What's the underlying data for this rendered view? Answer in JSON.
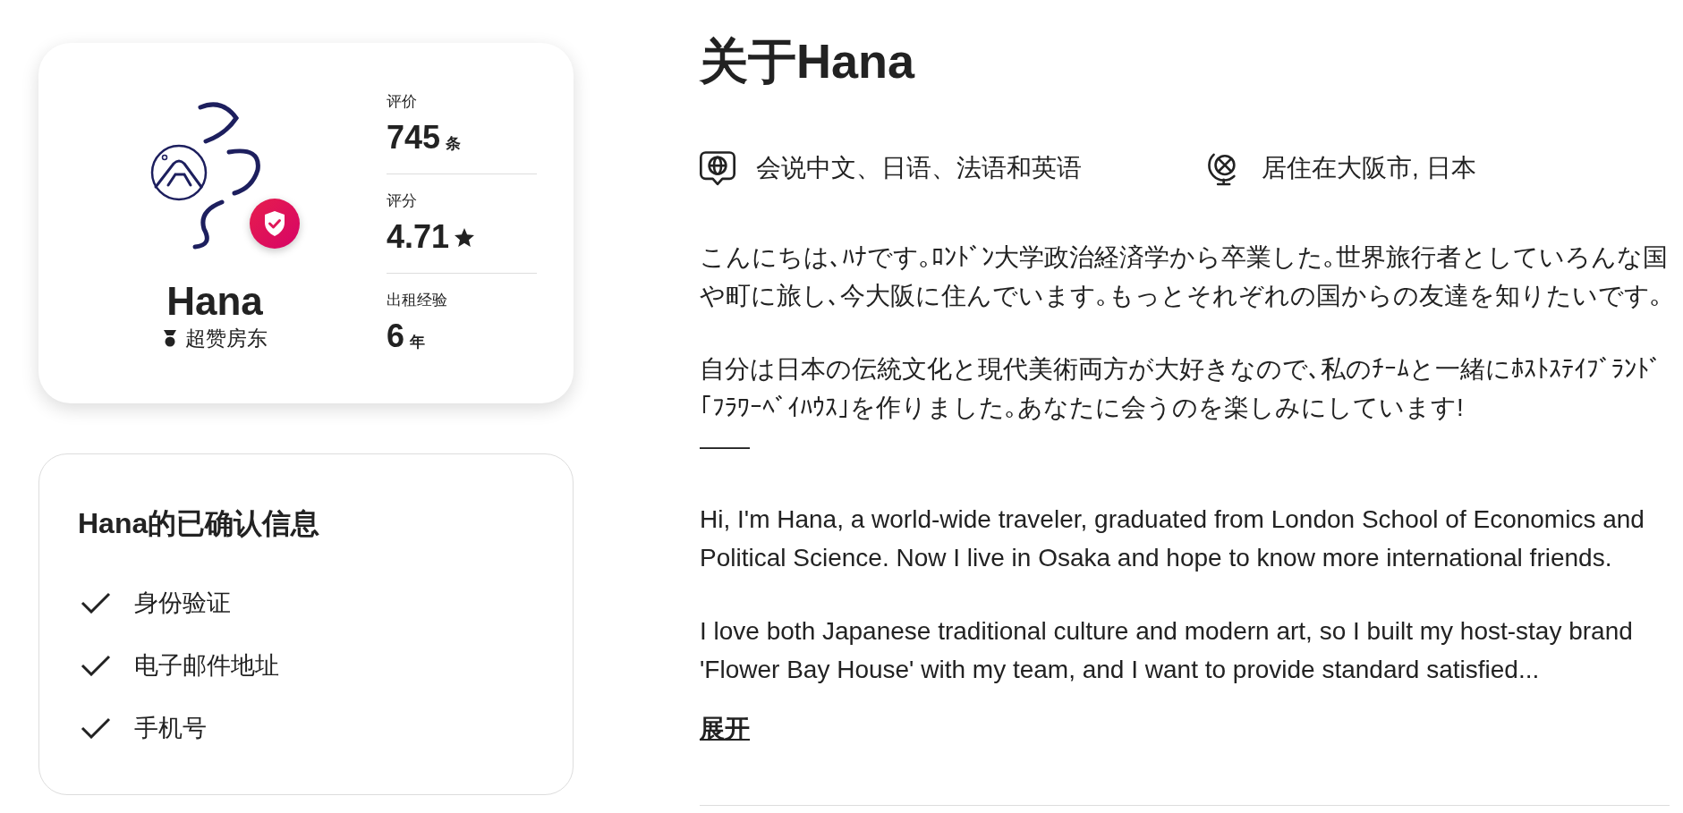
{
  "host_card": {
    "name": "Hana",
    "badge": "超赞房东",
    "stats": [
      {
        "kind": "count",
        "label": "评价",
        "value": "745",
        "unit": "条"
      },
      {
        "kind": "rating",
        "label": "评分",
        "value": "4.71"
      },
      {
        "kind": "count",
        "label": "出租经验",
        "value": "6",
        "unit": "年"
      }
    ]
  },
  "verified_info": {
    "title": "Hana的已确认信息",
    "items": [
      "身份验证",
      "电子邮件地址",
      "手机号"
    ]
  },
  "about": {
    "title": "关于Hana",
    "facts": [
      {
        "kind": "language",
        "text": "会说中文、日语、法语和英语"
      },
      {
        "kind": "location",
        "text": "居住在大阪市, 日本"
      }
    ],
    "paragraphs": [
      "こんにちは､ﾊﾅです｡ﾛﾝﾄﾞﾝ大学政治経済学から卒業した｡世界旅行者としていろんな国や町に旅し､今大阪に住んでいます｡もっとそれぞれの国からの友達を知りたいです｡",
      "自分は日本の伝統文化と現代美術両方が大好きなので､私のﾁｰﾑと一緒にﾎｽﾄｽﾃｲﾌﾞﾗﾝﾄﾞ｢ﾌﾗﾜｰﾍﾞｲﾊｳｽ｣を作りました｡あなたに会うのを楽しみにしています!\n——",
      "Hi, I'm Hana, a world-wide traveler, graduated from London School of Economics and Political Science. Now I live in Osaka and hope to know more international friends.",
      "I love both Japanese traditional culture and modern art, so I built my host-stay brand 'Flower Bay House' with my team, and I want to provide standard satisfied..."
    ],
    "show_more": "展开"
  }
}
